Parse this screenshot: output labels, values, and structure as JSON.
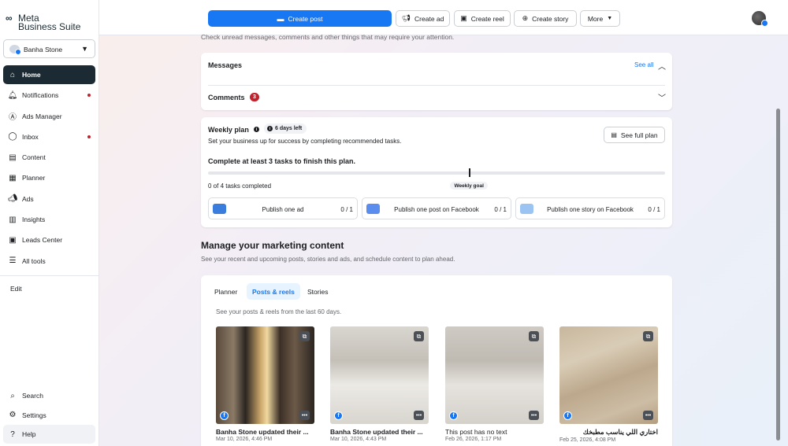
{
  "app": {
    "logo_mark": "∞",
    "logo_line1": "Meta",
    "logo_line2": "Business Suite"
  },
  "account": {
    "name": "Banha Stone",
    "caret": "▼"
  },
  "sidebar": {
    "items": [
      {
        "label": "Home",
        "icon": "home-icon",
        "glyph": "⌂",
        "active": true,
        "dot": false
      },
      {
        "label": "Notifications",
        "icon": "bell-icon",
        "glyph": "🔔︎",
        "active": false,
        "dot": true
      },
      {
        "label": "Ads Manager",
        "icon": "ads-manager-icon",
        "glyph": "Ⓐ",
        "active": false,
        "dot": false
      },
      {
        "label": "Inbox",
        "icon": "inbox-icon",
        "glyph": "◯",
        "active": false,
        "dot": true
      },
      {
        "label": "Content",
        "icon": "content-icon",
        "glyph": "▤",
        "active": false,
        "dot": false
      },
      {
        "label": "Planner",
        "icon": "calendar-icon",
        "glyph": "▦",
        "active": false,
        "dot": false
      },
      {
        "label": "Ads",
        "icon": "megaphone-icon",
        "glyph": "📣︎",
        "active": false,
        "dot": false
      },
      {
        "label": "Insights",
        "icon": "insights-icon",
        "glyph": "▥",
        "active": false,
        "dot": false
      },
      {
        "label": "Leads Center",
        "icon": "leads-icon",
        "glyph": "▣",
        "active": false,
        "dot": false
      },
      {
        "label": "All tools",
        "icon": "menu-icon",
        "glyph": "☰",
        "active": false,
        "dot": false
      }
    ],
    "edit_label": "Edit",
    "bottom": [
      {
        "label": "Search",
        "icon": "search-icon",
        "glyph": "⌕"
      },
      {
        "label": "Settings",
        "icon": "gear-icon",
        "glyph": "⚙"
      },
      {
        "label": "Help",
        "icon": "help-icon",
        "glyph": "?"
      }
    ]
  },
  "topbar": {
    "create_post": "Create post",
    "create_ad": "Create ad",
    "create_reel": "Create reel",
    "create_story": "Create story",
    "more": "More",
    "more_caret": "▼"
  },
  "main": {
    "intro": "Check unread messages, comments and other things that may require your attention.",
    "messages_title": "Messages",
    "see_all": "See all",
    "comments_title": "Comments",
    "comments_count": "3"
  },
  "weekly_plan": {
    "title": "Weekly plan",
    "days_left": "6 days left",
    "subtitle": "Set your business up for success by completing recommended tasks.",
    "see_full_plan": "See full plan",
    "goal_text": "Complete at least 3 tasks to finish this plan.",
    "completed_tasks": 0,
    "total_tasks": 4,
    "weekly_goal_tasks": 3,
    "goal_label": "Weekly goal",
    "tasks_completed_text": "0 of 4 tasks completed",
    "tasks": [
      {
        "label": "Publish one ad",
        "count": "0 / 1",
        "thumb_color": "#3b7ddd"
      },
      {
        "label": "Publish one post on Facebook",
        "count": "0 / 1",
        "thumb_color": "#5b8def"
      },
      {
        "label": "Publish one story on Facebook",
        "count": "0 / 1",
        "thumb_color": "#9cc4f2"
      }
    ]
  },
  "marketing": {
    "title": "Manage your marketing content",
    "subtitle": "See your recent and upcoming posts, stories and ads, and schedule content to plan ahead.",
    "tabs": [
      {
        "label": "Planner",
        "active": false
      },
      {
        "label": "Posts & reels",
        "active": true
      },
      {
        "label": "Stories",
        "active": false
      }
    ],
    "posts_subtitle": "See your posts & reels from the last 60 days.",
    "posts": [
      {
        "title": "Banha Stone updated their ...",
        "date": "Mar 10, 2026, 4:46 PM",
        "plain": false
      },
      {
        "title": "Banha Stone updated their ...",
        "date": "Mar 10, 2026, 4:43 PM",
        "plain": false
      },
      {
        "title": "This post has no text",
        "date": "Feb 26, 2026, 1:17 PM",
        "plain": true
      },
      {
        "title": "اختاري اللي يناسب مطبخك",
        "date": "Feb 25, 2026, 4:08 PM",
        "plain": false
      }
    ]
  },
  "colors": {
    "accent": "#1877f2",
    "nav_active": "#1c2b33",
    "notification_red": "#c0222d"
  }
}
